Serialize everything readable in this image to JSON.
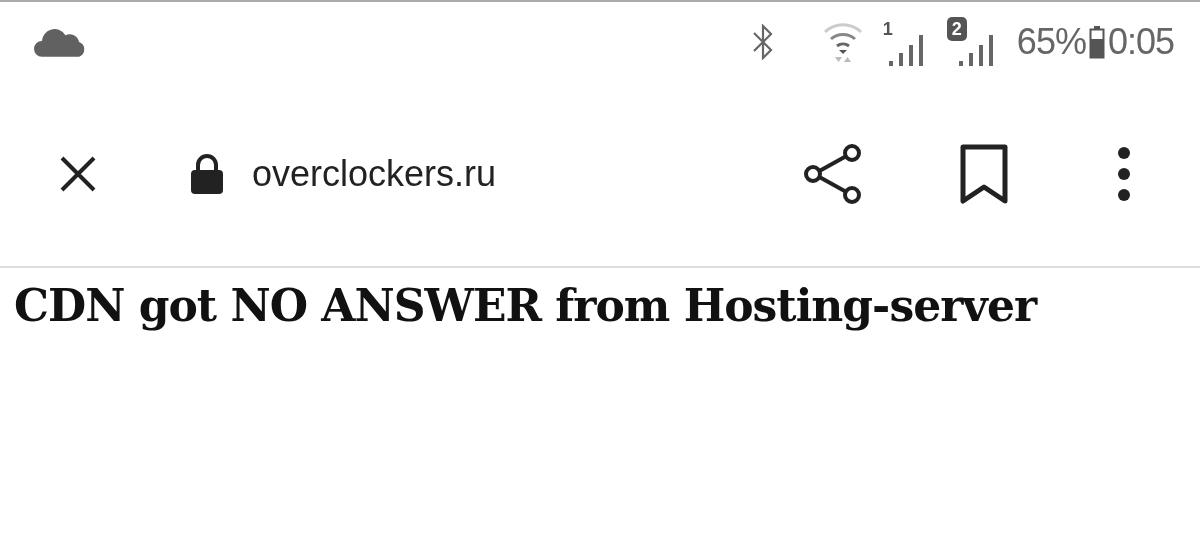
{
  "status_bar": {
    "sim_1_label": "1",
    "sim_2_label": "2",
    "battery": "65%",
    "time": "0:05"
  },
  "toolbar": {
    "url": "overclockers.ru"
  },
  "page": {
    "heading": "CDN got NO ANSWER from Hosting-server"
  }
}
